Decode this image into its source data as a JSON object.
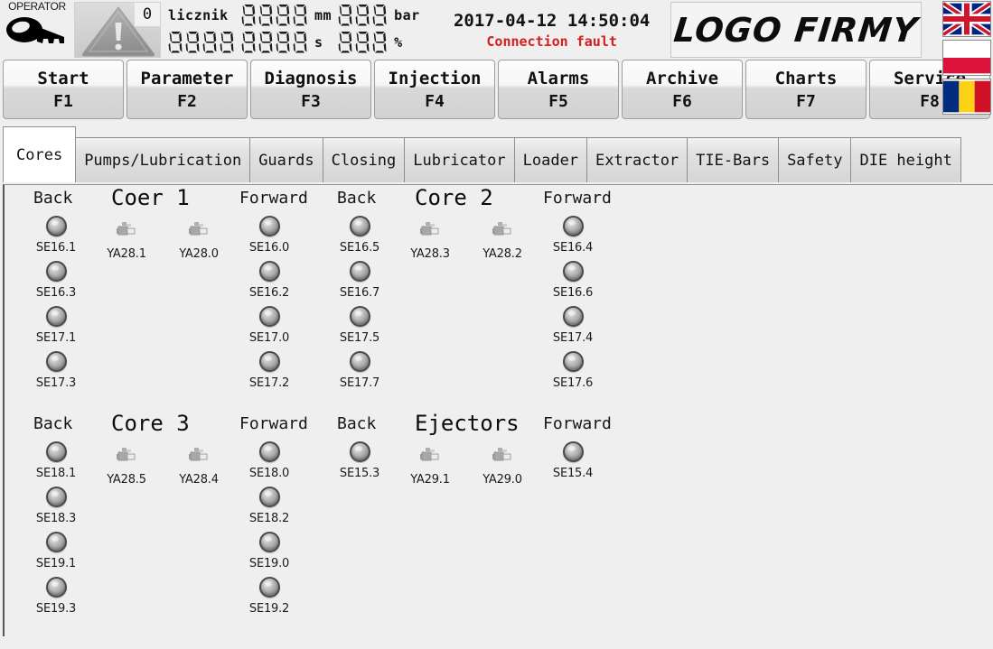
{
  "header": {
    "operator_label": "OPERATOR",
    "key_icon": "key-icon",
    "warning_icon": "warning-triangle-icon",
    "warning_count": "0",
    "counter_label": "licznik",
    "displays": [
      {
        "name": "counter-value",
        "digits": 4,
        "unit": ""
      },
      {
        "name": "position-mm",
        "digits": 4,
        "unit": "mm"
      },
      {
        "name": "pressure-bar",
        "digits": 3,
        "unit": "bar"
      },
      {
        "name": "cycle-count",
        "digits": 4,
        "unit": ""
      },
      {
        "name": "time-seconds",
        "digits": 4,
        "unit": "s"
      },
      {
        "name": "percent-value",
        "digits": 3,
        "unit": "%"
      }
    ],
    "datetime": "2017-04-12 14:50:04",
    "status_text": "Connection fault",
    "status_color": "#d42020",
    "logo_text": "LOGO FIRMY",
    "flags": [
      {
        "name": "flag-uk",
        "label": "United Kingdom"
      },
      {
        "name": "flag-poland",
        "label": "Poland"
      },
      {
        "name": "flag-romania",
        "label": "Romania"
      }
    ]
  },
  "function_keys": [
    {
      "title": "Start",
      "key": "F1"
    },
    {
      "title": "Parameter",
      "key": "F2"
    },
    {
      "title": "Diagnosis",
      "key": "F3"
    },
    {
      "title": "Injection",
      "key": "F4"
    },
    {
      "title": "Alarms",
      "key": "F5"
    },
    {
      "title": "Archive",
      "key": "F6"
    },
    {
      "title": "Charts",
      "key": "F7"
    },
    {
      "title": "Service",
      "key": "F8"
    }
  ],
  "tabs": [
    {
      "label": "Cores",
      "active": true
    },
    {
      "label": "Pumps/Lubrication",
      "active": false
    },
    {
      "label": "Guards",
      "active": false
    },
    {
      "label": "Closing",
      "active": false
    },
    {
      "label": "Lubricator",
      "active": false
    },
    {
      "label": "Loader",
      "active": false
    },
    {
      "label": "Extractor",
      "active": false
    },
    {
      "label": "TIE-Bars",
      "active": false
    },
    {
      "label": "Safety",
      "active": false
    },
    {
      "label": "DIE height",
      "active": false
    }
  ],
  "groups": [
    {
      "title": "Coer 1",
      "back_label": "Back",
      "forward_label": "Forward",
      "back": [
        "SE16.1",
        "SE16.3",
        "SE17.1",
        "SE17.3"
      ],
      "forward": [
        "SE16.0",
        "SE16.2",
        "SE17.0",
        "SE17.2"
      ],
      "valve_a": "YA28.1",
      "valve_b": "YA28.0"
    },
    {
      "title": "Core 2",
      "back_label": "Back",
      "forward_label": "Forward",
      "back": [
        "SE16.5",
        "SE16.7",
        "SE17.5",
        "SE17.7"
      ],
      "forward": [
        "SE16.4",
        "SE16.6",
        "SE17.4",
        "SE17.6"
      ],
      "valve_a": "YA28.3",
      "valve_b": "YA28.2"
    },
    {
      "title": "Core 3",
      "back_label": "Back",
      "forward_label": "Forward",
      "back": [
        "SE18.1",
        "SE18.3",
        "SE19.1",
        "SE19.3"
      ],
      "forward": [
        "SE18.0",
        "SE18.2",
        "SE19.0",
        "SE19.2"
      ],
      "valve_a": "YA28.5",
      "valve_b": "YA28.4"
    },
    {
      "title": "Ejectors",
      "back_label": "Back",
      "forward_label": "Forward",
      "back": [
        "SE15.3"
      ],
      "forward": [
        "SE15.4"
      ],
      "valve_a": "YA29.1",
      "valve_b": "YA29.0"
    }
  ],
  "colors": {
    "background": "#efefef",
    "panel": "#efefef",
    "fault_red": "#d42020",
    "tab_active_bg": "#ffffff",
    "led_off": "#b4b4b4"
  }
}
